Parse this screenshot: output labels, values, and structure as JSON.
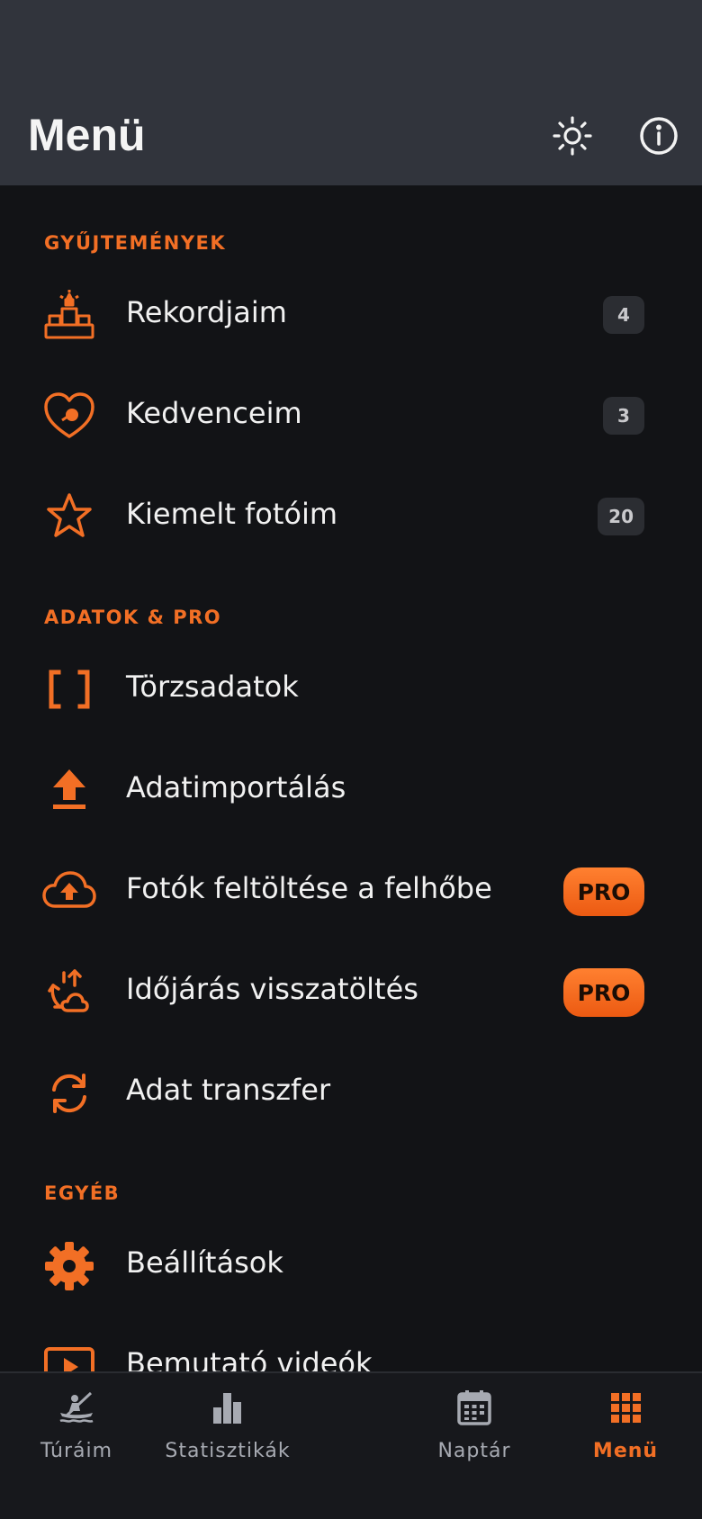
{
  "header": {
    "title": "Menü",
    "icons": [
      "brightness-icon",
      "info-icon"
    ]
  },
  "colors": {
    "accent": "#f26f25",
    "header_bg": "#31343c",
    "page_bg": "#121316",
    "text": "#f1f1f1",
    "badge_bg": "#2b2d32"
  },
  "sections": {
    "collections": {
      "label": "GYŰJTEMÉNYEK",
      "items": [
        {
          "label": "Rekordjaim",
          "icon": "podium-trophy-icon",
          "count": "4"
        },
        {
          "label": "Kedvenceim",
          "icon": "heart-icon",
          "count": "3"
        },
        {
          "label": "Kiemelt fotóim",
          "icon": "star-icon",
          "count": "20"
        }
      ]
    },
    "data_pro": {
      "label": "ADATOK & PRO",
      "items": [
        {
          "label": "Törzsadatok",
          "icon": "brackets-icon"
        },
        {
          "label": "Adatimportálás",
          "icon": "upload-icon"
        },
        {
          "label": "Fotók feltöltése a felhőbe",
          "icon": "cloud-upload-icon",
          "badge": "PRO"
        },
        {
          "label": "Időjárás visszatöltés",
          "icon": "weather-restore-icon",
          "badge": "PRO"
        },
        {
          "label": "Adat transzfer",
          "icon": "sync-icon"
        }
      ]
    },
    "other": {
      "label": "EGYÉB",
      "items": [
        {
          "label": "Beállítások",
          "icon": "gear-icon"
        },
        {
          "label": "Bemutató videók",
          "icon": "video-icon"
        }
      ]
    }
  },
  "tabbar": {
    "tabs": [
      {
        "label": "Túráim",
        "icon": "kayak-icon",
        "active": false
      },
      {
        "label": "Statisztikák",
        "icon": "bar-chart-icon",
        "active": false
      },
      {
        "label": "Naptár",
        "icon": "calendar-icon",
        "active": false
      },
      {
        "label": "Menü",
        "icon": "grid-icon",
        "active": true
      }
    ]
  }
}
